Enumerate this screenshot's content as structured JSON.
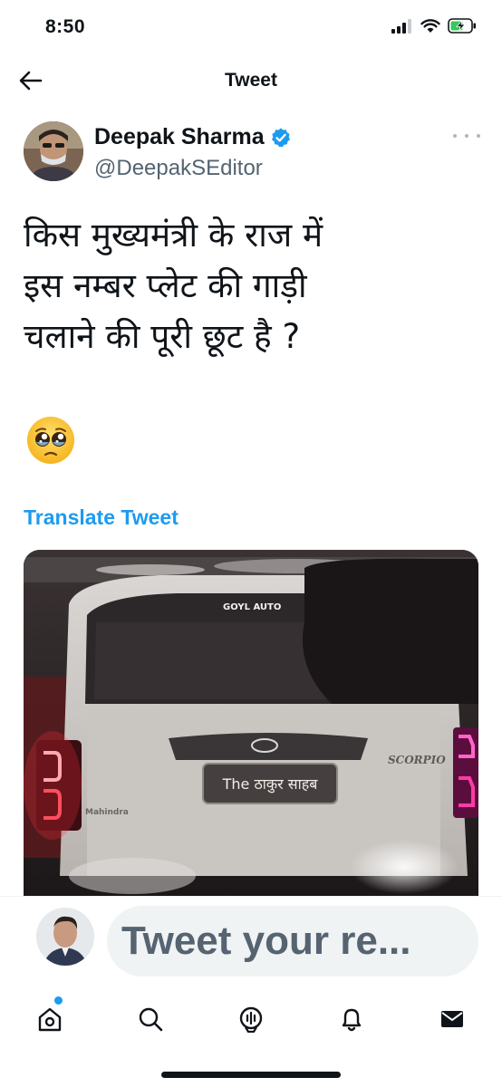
{
  "status_bar": {
    "time": "8:50"
  },
  "header": {
    "title": "Tweet"
  },
  "author": {
    "name": "Deepak Sharma",
    "handle": "@DeepakSEditor"
  },
  "tweet": {
    "text": "किस मुख्यमंत्री के राज में\nइस नम्बर प्लेट की गाड़ी\nचलाने की पूरी छूट है ?",
    "emoji": "pleading-face-icon"
  },
  "translate_label": "Translate Tweet",
  "photo": {
    "plate_text": "The ठाकुर साहब",
    "brand_text": "Mahindra",
    "model_text": "SCORPIO",
    "dealer_text": "GOYL AUTO"
  },
  "reply": {
    "placeholder": "Tweet your re..."
  },
  "tabs": [
    "home-icon",
    "search-icon",
    "spaces-icon",
    "notifications-icon",
    "messages-icon"
  ],
  "colors": {
    "accent": "#1d9bf0",
    "text": "#0f1419",
    "secondary": "#536471"
  }
}
